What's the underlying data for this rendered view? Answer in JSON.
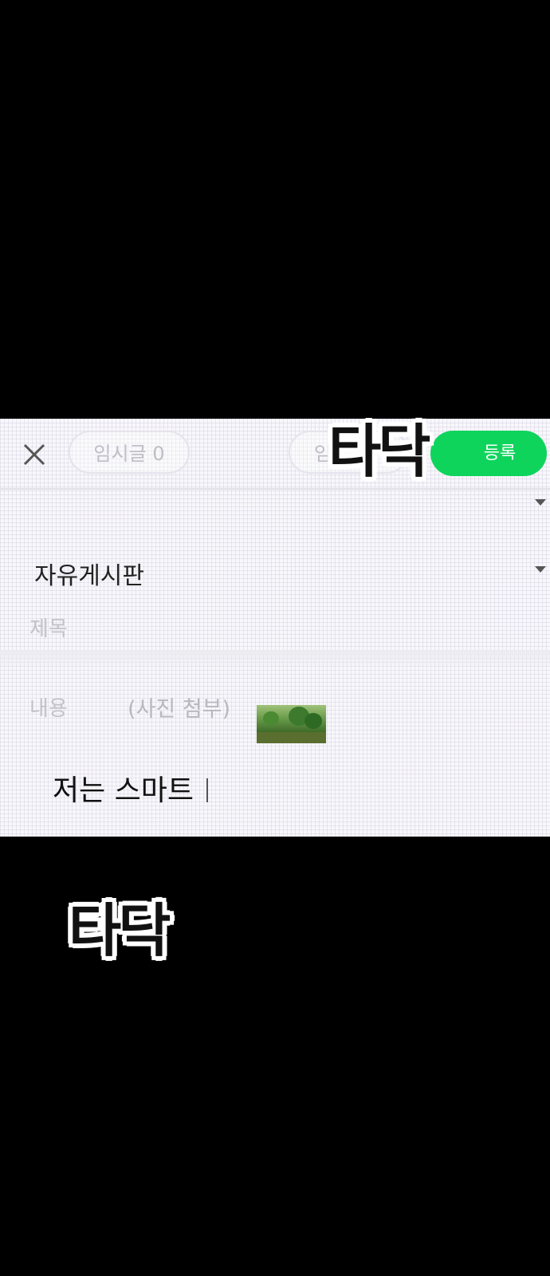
{
  "toolbar": {
    "temp_label": "임시글 0",
    "mid_label": "임",
    "register_label": "등록"
  },
  "form": {
    "board_name": "자유게시판",
    "title_placeholder": "제목",
    "content_placeholder": "내용",
    "attach_label": "(사진 첨부)",
    "typed_text": "저는 스마트"
  },
  "sound_effects": {
    "top": "타닥",
    "bottom": "타닥"
  },
  "colors": {
    "accent": "#0fd45c",
    "background": "#000000"
  },
  "icons": [
    "close-icon",
    "dropdown-caret-icon",
    "image-thumbnail"
  ]
}
